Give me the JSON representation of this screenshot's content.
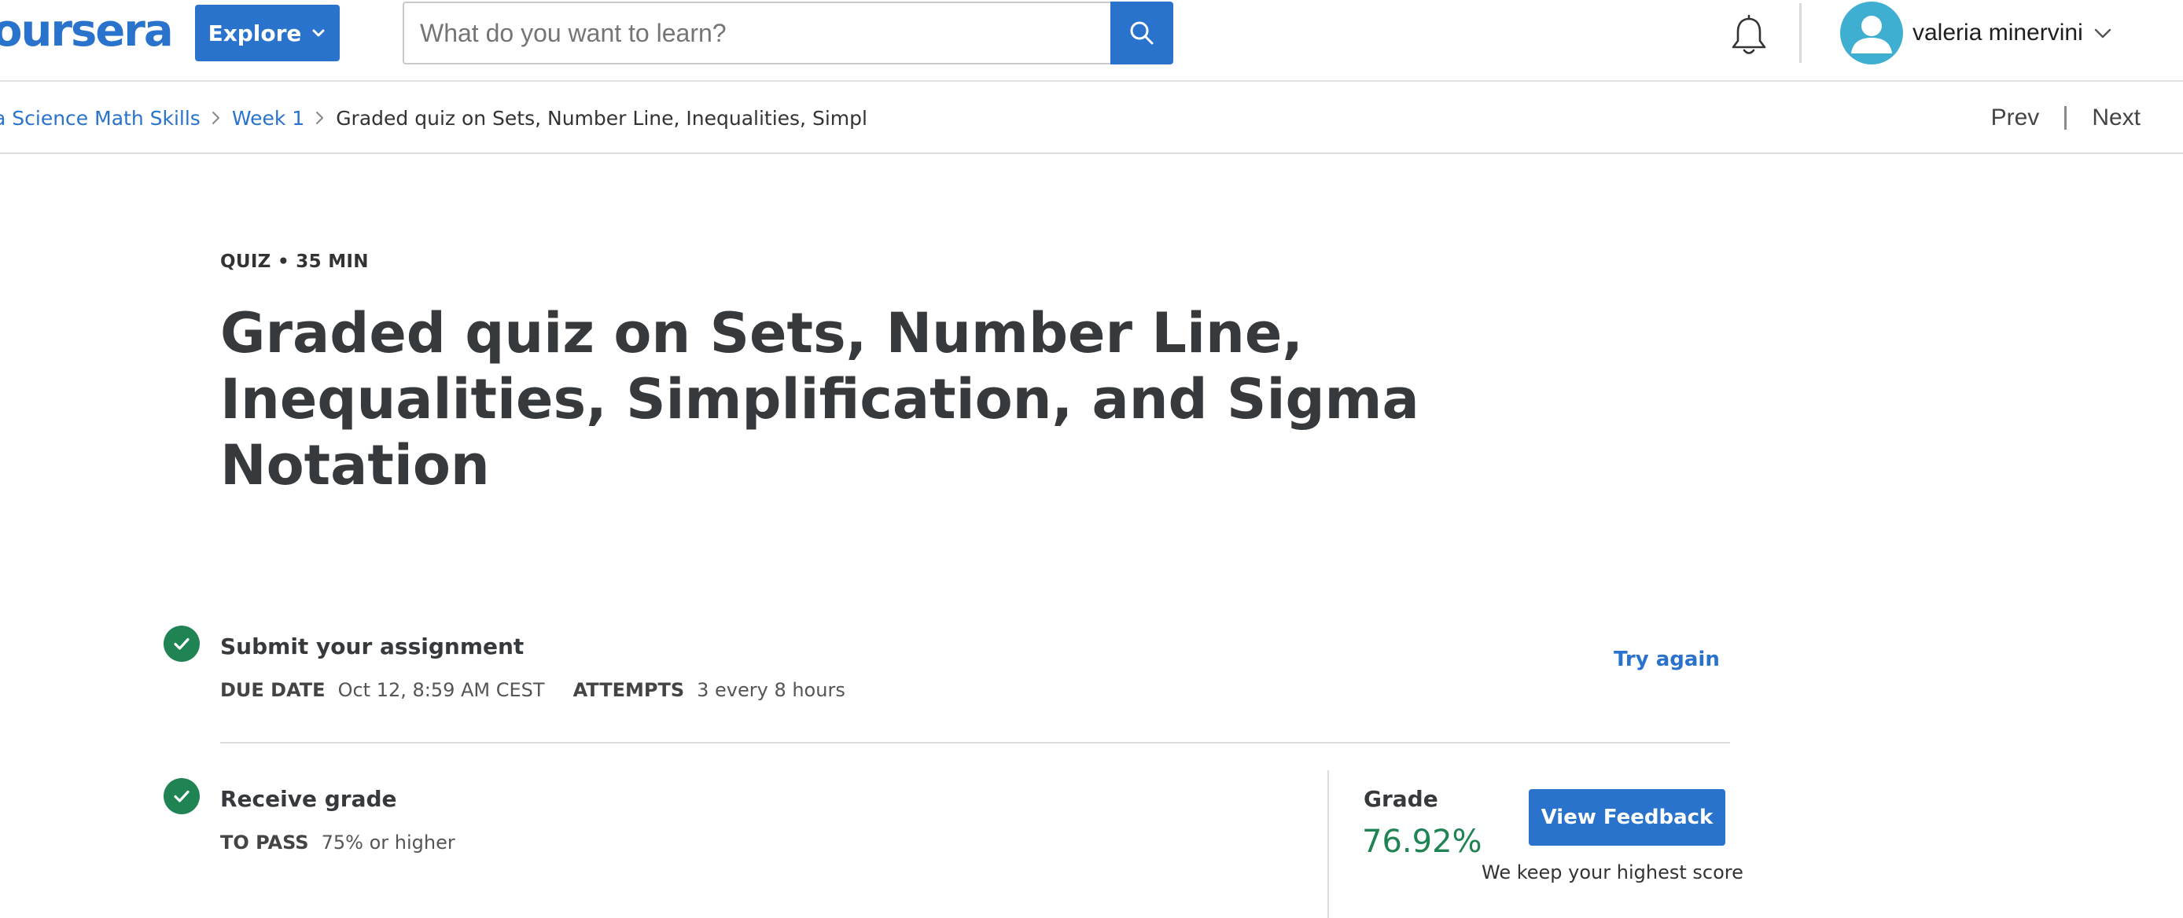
{
  "header": {
    "logo_text": "oursera",
    "explore_label": "Explore",
    "search_placeholder": "What do you want to learn?",
    "user_name": "valeria minervini"
  },
  "breadcrumb": {
    "items": [
      {
        "label": "a Science Math Skills"
      },
      {
        "label": "Week 1"
      },
      {
        "label": "Graded quiz on Sets, Number Line, Inequalities, Simpl"
      }
    ],
    "prev_label": "Prev",
    "next_label": "Next"
  },
  "quiz": {
    "meta": "QUIZ • 35 MIN",
    "title": "Graded quiz on Sets, Number Line, Inequalities, Simplification, and Sigma Notation"
  },
  "submit_step": {
    "title": "Submit your assignment",
    "due_date_label": "DUE DATE",
    "due_date_value": "Oct 12, 8:59 AM CEST",
    "attempts_label": "ATTEMPTS",
    "attempts_value": "3 every 8 hours",
    "try_again_label": "Try again"
  },
  "grade_step": {
    "title": "Receive grade",
    "to_pass_label": "TO PASS",
    "to_pass_value": "75% or higher",
    "grade_label": "Grade",
    "grade_value": "76.92%",
    "view_feedback_label": "View Feedback",
    "highest_score_note": "We keep your highest score"
  },
  "colors": {
    "brand_blue": "#2a73cc",
    "success_green": "#1f8354",
    "avatar_teal": "#3eaed1"
  },
  "icons": [
    "search-icon",
    "chevron-down-icon",
    "bell-icon",
    "user-avatar-icon",
    "chevron-right-icon",
    "check-icon"
  ]
}
